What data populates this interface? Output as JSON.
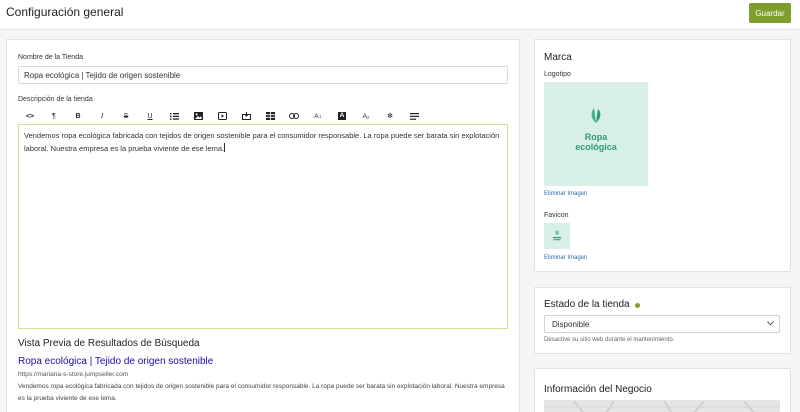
{
  "header": {
    "title": "Configuración general",
    "save_label": "Guardar"
  },
  "store": {
    "name_label": "Nombre de la Tienda",
    "name_value": "Ropa ecológica | Tejido de origen sostenible",
    "description_label": "Descripción de la tienda",
    "description_value": "Vendemos ropa ecológica fabricada con tejidos de origen sostenible para el consumidor responsable. La ropa puede ser barata sin explotación laboral. Nuestra empresa es la prueba viviente de ese lema."
  },
  "toolbar": [
    {
      "name": "code-view-icon",
      "glyph": "<>"
    },
    {
      "name": "paragraph-icon",
      "glyph": "¶"
    },
    {
      "name": "bold-icon",
      "glyph": "B"
    },
    {
      "name": "italic-icon",
      "glyph": "I"
    },
    {
      "name": "strikethrough-icon",
      "glyph": "S"
    },
    {
      "name": "underline-icon",
      "glyph": "U"
    },
    {
      "name": "list-icon",
      "glyph": ""
    },
    {
      "name": "image-icon",
      "glyph": ""
    },
    {
      "name": "video-icon",
      "glyph": ""
    },
    {
      "name": "embed-icon",
      "glyph": ""
    },
    {
      "name": "table-icon",
      "glyph": ""
    },
    {
      "name": "link-icon",
      "glyph": ""
    },
    {
      "name": "font-size-icon",
      "glyph": "A↕"
    },
    {
      "name": "text-color-icon",
      "glyph": "A"
    },
    {
      "name": "subscript-icon",
      "glyph": "A₂"
    },
    {
      "name": "special-chars-icon",
      "glyph": "✻"
    },
    {
      "name": "align-icon",
      "glyph": ""
    }
  ],
  "seo": {
    "heading": "Vista Previa de Resultados de Búsqueda",
    "title": "Ropa ecológica | Tejido de origen sostenible",
    "url": "https://mariana-s-store.jumpseller.com",
    "description": "Vendemos ropa ecológica fabricada con tejidos de origen sostenible para el consumidor responsable. La ropa puede ser barata sin explotación laboral. Nuestra empresa es la prueba viviente de ese lema."
  },
  "brand": {
    "heading": "Marca",
    "logo_label": "Logotipo",
    "logo_text_1": "Ropa",
    "logo_text_2": "ecológica",
    "remove_logo": "Eliminar Imagen",
    "favicon_label": "Favicon",
    "favicon_text": "Ropa ecológica",
    "remove_favicon": "Eliminar Imagen"
  },
  "status": {
    "heading": "Estado de la tienda",
    "selected": "Disponible",
    "hint": "Desactive su sitio web durante el mantenimiento."
  },
  "business": {
    "heading": "Información del Negocio"
  },
  "colors": {
    "accent": "#7e9e2e",
    "link": "#1a0dab",
    "logo_bg": "#d9f0e9",
    "logo_green": "#2f9a77"
  }
}
